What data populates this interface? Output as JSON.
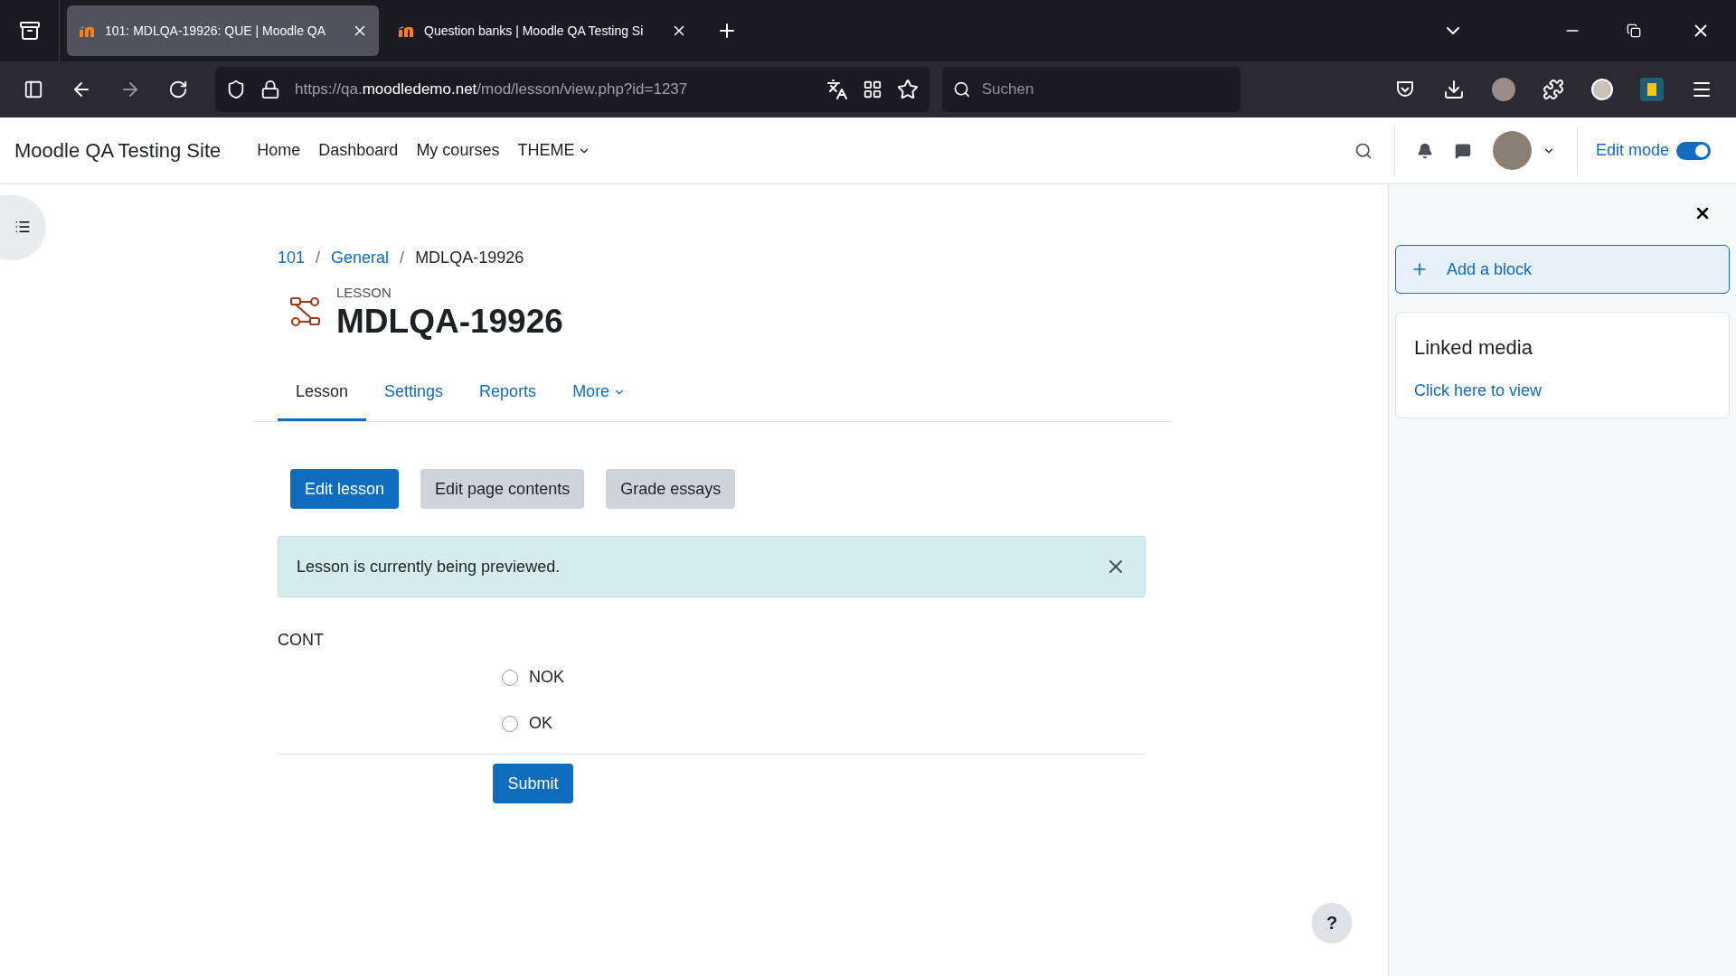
{
  "browser": {
    "tabs": [
      {
        "title": "101: MDLQA-19926: QUE | Moodle QA",
        "selected": true
      },
      {
        "title": "Question banks | Moodle QA Testing Si",
        "selected": false
      }
    ],
    "url": {
      "scheme": "https://qa.",
      "host": "moodledemo.net",
      "path": "/mod/lesson/view.php?id=1237"
    },
    "search": {
      "placeholder": "Suchen"
    }
  },
  "navbar": {
    "site_name": "Moodle QA Testing Site",
    "items": [
      {
        "label": "Home",
        "dropdown": false
      },
      {
        "label": "Dashboard",
        "dropdown": false
      },
      {
        "label": "My courses",
        "dropdown": false
      },
      {
        "label": "THEME",
        "dropdown": true
      }
    ],
    "edit_mode": {
      "label": "Edit mode",
      "on": true
    }
  },
  "breadcrumb": [
    {
      "kind": "link",
      "label": "101"
    },
    {
      "kind": "separator",
      "label": "/"
    },
    {
      "kind": "link",
      "label": "General"
    },
    {
      "kind": "separator",
      "label": "/"
    },
    {
      "kind": "current",
      "label": "MDLQA-19926"
    }
  ],
  "header": {
    "kind_label": "LESSON",
    "title": "MDLQA-19926"
  },
  "tabs": [
    {
      "label": "Lesson",
      "selected": true,
      "dropdown": false
    },
    {
      "label": "Settings",
      "selected": false,
      "dropdown": false
    },
    {
      "label": "Reports",
      "selected": false,
      "dropdown": false
    },
    {
      "label": "More",
      "selected": false,
      "dropdown": true
    }
  ],
  "actions": [
    {
      "label": "Edit lesson",
      "primary": true
    },
    {
      "label": "Edit page contents",
      "primary": false
    },
    {
      "label": "Grade essays",
      "primary": false
    }
  ],
  "alert": {
    "text": "Lesson is currently being previewed."
  },
  "question": {
    "title": "CONT",
    "options": [
      {
        "label": "NOK",
        "checked": false
      },
      {
        "label": "OK",
        "checked": false
      }
    ],
    "submit": "Submit"
  },
  "drawer": {
    "add_block": "Add a block",
    "block": {
      "title": "Linked media",
      "link": "Click here to view"
    }
  },
  "help": {
    "label": "?"
  }
}
